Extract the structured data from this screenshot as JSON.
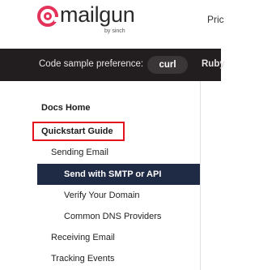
{
  "header": {
    "logo_text": "mailgun",
    "logo_byline": "by sinch",
    "nav_link_partial": "Pric"
  },
  "code_pref": {
    "label": "Code sample preference:",
    "selected": "curl",
    "next_option_partial": "Ruby"
  },
  "sidebar": {
    "items": [
      {
        "label": "Docs Home"
      },
      {
        "label": "Quickstart Guide"
      },
      {
        "label": "Sending Email"
      },
      {
        "label": "Send with SMTP or API"
      },
      {
        "label": "Verify Your Domain"
      },
      {
        "label": "Common DNS Providers"
      },
      {
        "label": "Receiving Email"
      },
      {
        "label": "Tracking Events"
      }
    ]
  },
  "colors": {
    "brand": "#e4335b",
    "pref_bar": "#221e1f",
    "active_bg": "#1f2a44",
    "highlight_border": "#e4141e"
  }
}
